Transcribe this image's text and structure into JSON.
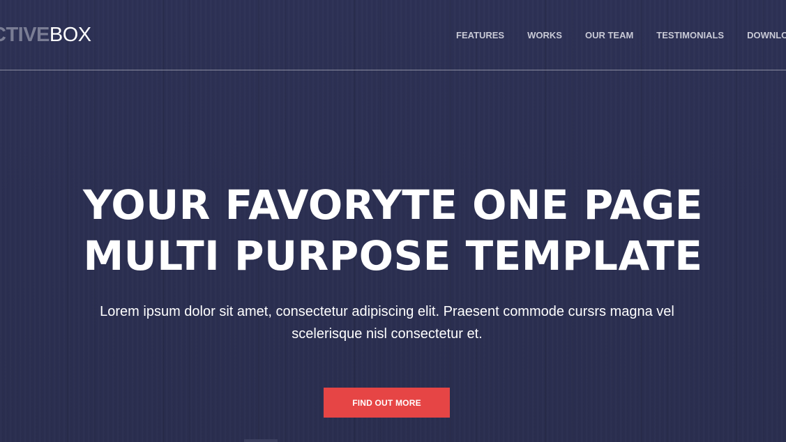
{
  "header": {
    "logo_part1": "CTIVE",
    "logo_part2": "BOX",
    "nav": [
      {
        "label": "FEATURES"
      },
      {
        "label": "WORKS"
      },
      {
        "label": "OUR TEAM"
      },
      {
        "label": "TESTIMONIALS"
      },
      {
        "label": "DOWNLOAD"
      }
    ]
  },
  "hero": {
    "title_line1": "YOUR FAVORYTE ONE PAGE",
    "title_line2": "MULTI PURPOSE TEMPLATE",
    "text_line1": "Lorem ipsum dolor sit amet, consectetur adipiscing elit. Praesent commode cursrs magna vel",
    "text_line2": "scelerisque nisl consectetur et.",
    "cta_label": "FIND OUT MORE"
  },
  "colors": {
    "background": "#2c3052",
    "accent": "#e64545",
    "logo_muted": "#7a7d94"
  }
}
